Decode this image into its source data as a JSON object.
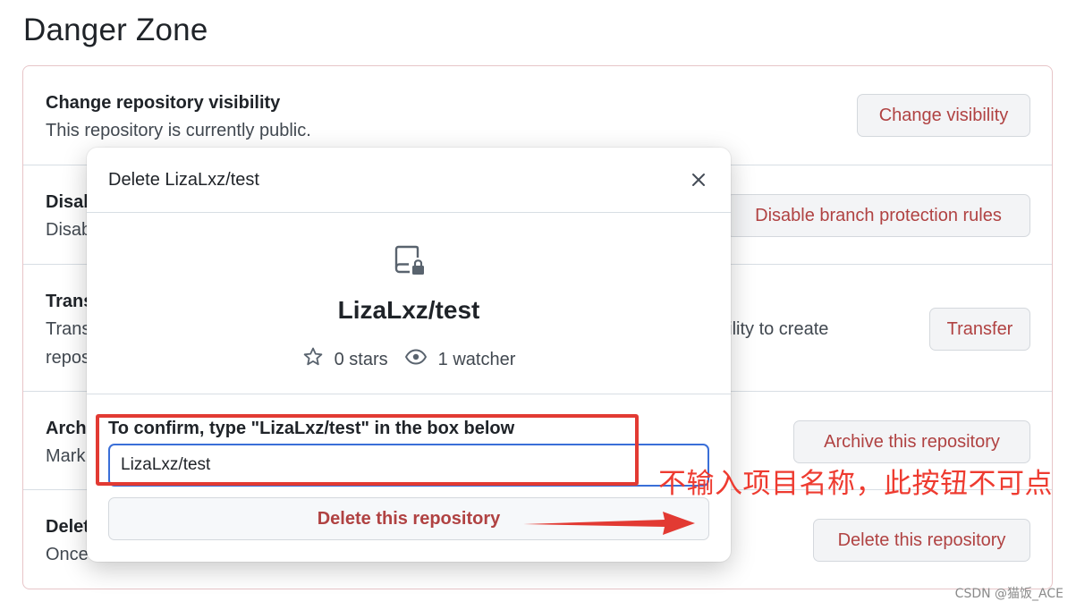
{
  "page": {
    "title": "Danger Zone"
  },
  "danger_zone": {
    "rows": [
      {
        "title": "Change repository visibility",
        "description": "This repository is currently public.",
        "button": "Change visibility"
      },
      {
        "title": "Disab",
        "description": "Disab",
        "button": "Disable branch protection rules"
      },
      {
        "title": "Trans",
        "description_line1": "Trans",
        "description_line1_tail": "bility to create",
        "description_line2": "repos",
        "button": "Transfer"
      },
      {
        "title": "Archi",
        "description": "Mark",
        "button": "Archive this repository"
      },
      {
        "title": "Delet",
        "description": "Once",
        "button": "Delete this repository"
      }
    ]
  },
  "modal": {
    "title": "Delete LizaLxz/test",
    "close_icon": "x-icon",
    "repo_icon": "repo-locked-icon",
    "repo_name": "LizaLxz/test",
    "stars_label": "0 stars",
    "watchers_label": "1 watcher",
    "confirm_label": "To confirm, type \"LizaLxz/test\" in the box below",
    "confirm_value": "LizaLxz/test",
    "delete_button": "Delete this repository"
  },
  "annotation": {
    "text": "不输入项目名称，此按钮不可点",
    "color": "#e23a33"
  },
  "watermark": "CSDN @猫饭_ACE",
  "colors": {
    "danger_text": "#b04242",
    "danger_border": "#e7c5c8",
    "focus_border": "#3a6fd8"
  }
}
